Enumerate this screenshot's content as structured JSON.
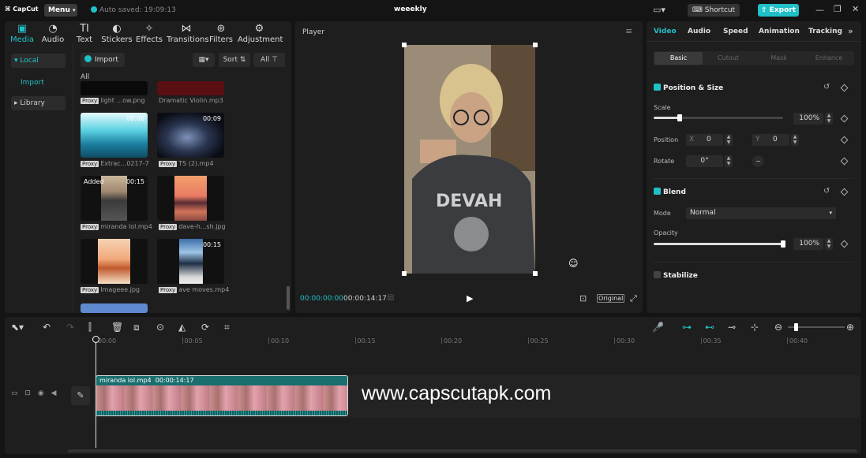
{
  "app": {
    "logo": "CapCut",
    "menu": "Menu",
    "autosave": "Auto saved: 19:09:13",
    "project": "weeekly",
    "shortcut": "Shortcut",
    "export": "Export"
  },
  "media_tabs": [
    {
      "label": "Media",
      "icon": "media-icon"
    },
    {
      "label": "Audio",
      "icon": "audio-icon"
    },
    {
      "label": "Text",
      "icon": "text-icon"
    },
    {
      "label": "Stickers",
      "icon": "stickers-icon"
    },
    {
      "label": "Effects",
      "icon": "effects-icon"
    },
    {
      "label": "Transitions",
      "icon": "transitions-icon"
    },
    {
      "label": "Filters",
      "icon": "filters-icon"
    },
    {
      "label": "Adjustment",
      "icon": "adjustment-icon"
    }
  ],
  "media_side": {
    "local": "Local",
    "import": "Import",
    "library": "Library"
  },
  "media_bar": {
    "import": "Import",
    "sort": "Sort",
    "all": "All",
    "section": "All"
  },
  "media_items": [
    {
      "name": "light ...ow.png",
      "proxy": "Proxy",
      "duration": "",
      "added": ""
    },
    {
      "name": "Dramatic Violin.mp3",
      "proxy": "",
      "duration": "",
      "added": ""
    },
    {
      "name": "Extrac...0217-7",
      "proxy": "Proxy",
      "duration": "00:06",
      "added": ""
    },
    {
      "name": "TS (2).mp4",
      "proxy": "Proxy",
      "duration": "00:09",
      "added": ""
    },
    {
      "name": "miranda lol.mp4",
      "proxy": "Proxy",
      "duration": "00:15",
      "added": "Added"
    },
    {
      "name": "dave-h...sh.jpg",
      "proxy": "Proxy",
      "duration": "",
      "added": ""
    },
    {
      "name": "Imageee.jpg",
      "proxy": "Proxy",
      "duration": "",
      "added": ""
    },
    {
      "name": "ave moves.mp4",
      "proxy": "Proxy",
      "duration": "00:15",
      "added": ""
    }
  ],
  "player": {
    "title": "Player",
    "current": "00:00:00:00",
    "total": "00:00:14:17",
    "original": "Original"
  },
  "props": {
    "tabs": [
      "Video",
      "Audio",
      "Speed",
      "Animation",
      "Tracking"
    ],
    "subtabs": [
      "Basic",
      "Cutout",
      "Mask",
      "Enhance"
    ],
    "position_size": "Position & Size",
    "scale_label": "Scale",
    "scale_value": "100%",
    "scale_fraction": 0.2,
    "position_label": "Position",
    "x_label": "X",
    "x_value": "0",
    "y_label": "Y",
    "y_value": "0",
    "rotate_label": "Rotate",
    "rotate_value": "0°",
    "blend": "Blend",
    "mode_label": "Mode",
    "mode_value": "Normal",
    "opacity_label": "Opacity",
    "opacity_value": "100%",
    "opacity_fraction": 1.0,
    "stabilize": "Stabilize"
  },
  "timeline": {
    "ticks": [
      "00:00",
      "00:05",
      "00:10",
      "00:15",
      "00:20",
      "00:25",
      "00:30",
      "00:35",
      "00:40"
    ],
    "clip_name": "miranda lol.mp4",
    "clip_duration": "00:00:14:17",
    "watermark": "www.capscutapk.com"
  },
  "colors": {
    "accent": "#1fc0c7",
    "clip": "#1a6e6e"
  }
}
